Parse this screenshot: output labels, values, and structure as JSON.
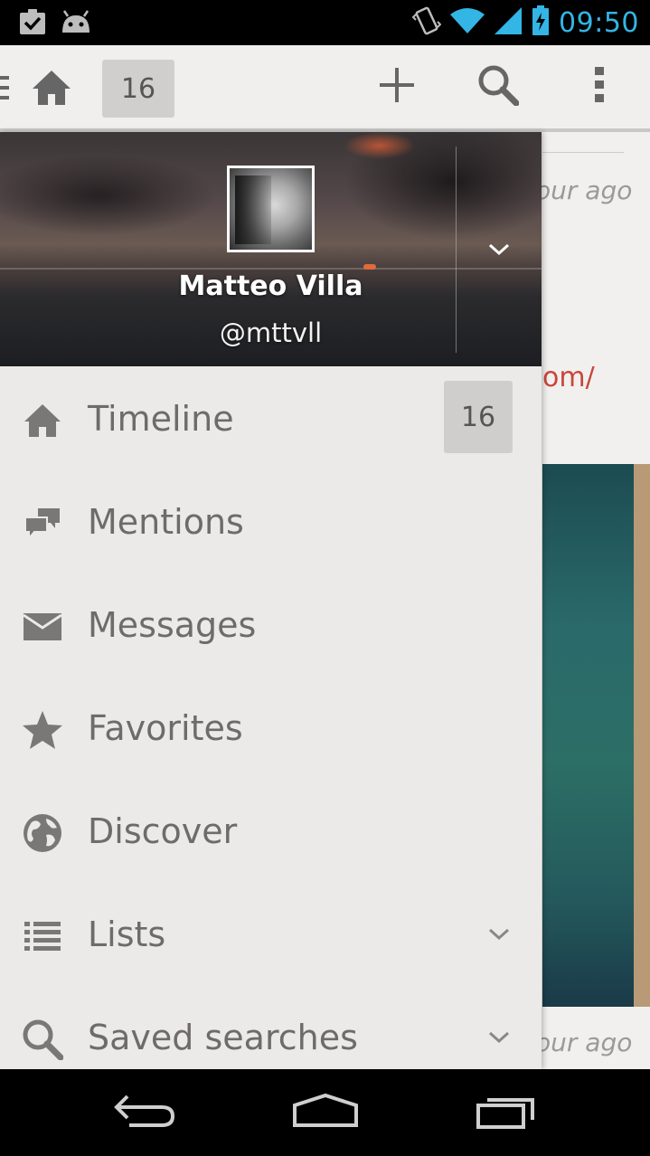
{
  "status_bar": {
    "time": "09:50",
    "icons": [
      "task-check-icon",
      "android-icon",
      "vibrate-icon",
      "wifi-icon",
      "signal-icon",
      "battery-charging-icon"
    ]
  },
  "action_bar": {
    "unread_count": "16",
    "icons": [
      "drawer-indicator-icon",
      "home-icon",
      "add-icon",
      "search-icon",
      "overflow-menu-icon"
    ]
  },
  "background_content": {
    "time_top": "our ago",
    "link_fragment": "om/",
    "time_bottom": "our ago"
  },
  "drawer": {
    "profile": {
      "name": "Matteo Villa",
      "handle": "@mttvll"
    },
    "items": [
      {
        "label": "Timeline",
        "icon": "home-icon",
        "badge": "16"
      },
      {
        "label": "Mentions",
        "icon": "chat-bubbles-icon"
      },
      {
        "label": "Messages",
        "icon": "envelope-icon"
      },
      {
        "label": "Favorites",
        "icon": "star-icon"
      },
      {
        "label": "Discover",
        "icon": "globe-icon"
      },
      {
        "label": "Lists",
        "icon": "list-icon",
        "expandable": true
      },
      {
        "label": "Saved searches",
        "icon": "search-icon",
        "expandable": true
      }
    ]
  },
  "nav_bar": {
    "icons": [
      "back-icon",
      "home-icon",
      "recents-icon"
    ]
  },
  "colors": {
    "clock": "#33b5e5",
    "drawer_bg": "#eceae8",
    "label_text": "#6e6c6a",
    "link": "#c9463b"
  }
}
